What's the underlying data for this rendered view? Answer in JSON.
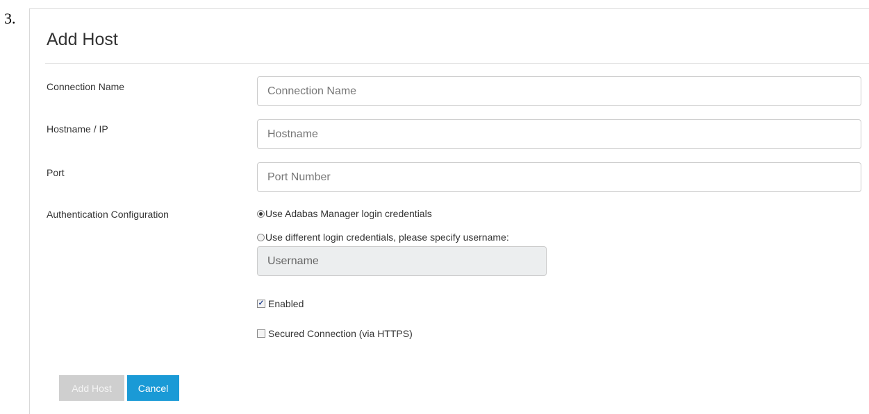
{
  "step": {
    "number": "3."
  },
  "form": {
    "title": "Add Host",
    "fields": {
      "connection_name": {
        "label": "Connection Name",
        "placeholder": "Connection Name",
        "value": ""
      },
      "hostname": {
        "label": "Hostname / IP",
        "placeholder": "Hostname",
        "value": ""
      },
      "port": {
        "label": "Port",
        "placeholder": "Port Number",
        "value": ""
      }
    },
    "authentication": {
      "label": "Authentication Configuration",
      "options": [
        {
          "label": "Use Adabas Manager login credentials",
          "selected": true
        },
        {
          "label": "Use different login credentials, please specify username:",
          "selected": false
        }
      ],
      "username": {
        "placeholder": "Username",
        "value": "",
        "disabled": true
      }
    },
    "checkboxes": {
      "enabled": {
        "label": "Enabled",
        "checked": true
      },
      "secured": {
        "label": "Secured Connection (via HTTPS)",
        "checked": false
      }
    },
    "buttons": {
      "add_host": {
        "label": "Add Host",
        "disabled": true
      },
      "cancel": {
        "label": "Cancel"
      }
    }
  },
  "colors": {
    "primary_button": "#1a9ad6",
    "disabled_button": "#cfcfcf",
    "disabled_input": "#eceeef"
  },
  "icons": {
    "checkmark": "✓"
  }
}
